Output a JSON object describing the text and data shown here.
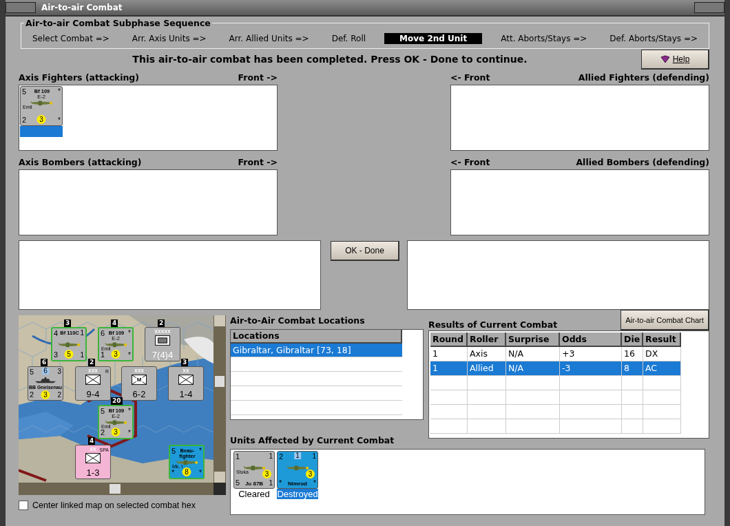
{
  "window": {
    "title": "Air-to-air Combat"
  },
  "sequence": {
    "title": "Air-to-air Combat Subphase Sequence",
    "steps": [
      {
        "label": "Select Combat =>",
        "selected": false
      },
      {
        "label": "Arr. Axis Units =>",
        "selected": false
      },
      {
        "label": "Arr. Allied Units =>",
        "selected": false
      },
      {
        "label": "Def. Roll",
        "selected": false
      },
      {
        "label": "Move 2nd Unit",
        "selected": true
      },
      {
        "label": "Att. Aborts/Stays =>",
        "selected": false
      },
      {
        "label": "Def. Aborts/Stays =>",
        "selected": false
      }
    ]
  },
  "message": "This air-to-air combat has been completed.  Press OK - Done to continue.",
  "help_button": "Help",
  "panels": [
    {
      "title": "Axis Fighters (attacking)",
      "front": "Front ->",
      "units": [
        {
          "selected": true,
          "counter": {
            "kind": "air",
            "color": "#b4b4b4",
            "tl": "5",
            "tr": "*",
            "name": "Bf 109",
            "sub": "E-2",
            "label": "Emil",
            "bl": "2",
            "mid": "3",
            "br": "*"
          }
        }
      ]
    },
    {
      "title": "Allied Fighters (defending)",
      "front": "<- Front"
    },
    {
      "title": "Axis Bombers (attacking)",
      "front": "Front ->"
    },
    {
      "title": "Allied Bombers (defending)",
      "front": "<- Front"
    }
  ],
  "ok_button": "OK - Done",
  "map": {
    "counters": [
      {
        "kind": "air",
        "color": "#b4b4b4",
        "stack": "3",
        "tl": "4",
        "tr": "1",
        "name": "Bf 110C",
        "bl": "3",
        "mid": "5",
        "br": "1"
      },
      {
        "kind": "air",
        "color": "#b4b4b4",
        "stack": "4",
        "tl": "6",
        "tr": "*",
        "name": "Bf 109",
        "sub": "E-2",
        "label": "Emil",
        "bl": "1",
        "mid": "3",
        "br": "*"
      },
      {
        "kind": "hq",
        "color": "#b4b4b4",
        "stack": "2",
        "size": "XXXXX",
        "value": "7(4)4"
      },
      {
        "kind": "naval",
        "color": "#b4b4b4",
        "stack": "6",
        "tl": "5",
        "tm": "6",
        "tr": "3",
        "name": "BB Gneisenau",
        "bl": "2",
        "mid": "3",
        "br": "2"
      },
      {
        "kind": "land",
        "color": "#b4b4b4",
        "stack": "2",
        "size": "XXX",
        "tr": "R",
        "value": "9-4"
      },
      {
        "kind": "land",
        "color": "#b4b4b4",
        "size": "XXX",
        "symbol": "M",
        "value": "6-2"
      },
      {
        "kind": "land",
        "color": "#b4b4b4",
        "stack": "3",
        "size": "XX",
        "value": "1-4"
      },
      {
        "kind": "air",
        "color": "#b4b4b4",
        "stack": "20",
        "tl": "5",
        "tr": "*",
        "name": "Bf 109",
        "sub": "E-2",
        "label": "Emil",
        "bl": "2",
        "mid": "3",
        "br": "*"
      },
      {
        "kind": "land",
        "color": "#f4b4d4",
        "stack": "4",
        "size": "XX",
        "tr": "SPA",
        "value": "1-3"
      },
      {
        "kind": "air",
        "color": "#1e9ad8",
        "tl": "5",
        "tr": "*",
        "name": "Beau-fighter",
        "label": "Mk. I",
        "bl": "*",
        "mid": "8",
        "br": "*"
      }
    ]
  },
  "center_checkbox": {
    "label": "Center linked map on selected combat hex",
    "checked": false
  },
  "locations": {
    "title": "Air-to-Air Combat Locations",
    "column": "Locations",
    "rows": [
      {
        "text": "Gibraltar, Gibraltar [73, 18]",
        "selected": true
      }
    ]
  },
  "results": {
    "title": "Results of Current Combat",
    "chart_button": "Air-to-air Combat Chart",
    "columns": [
      "Round",
      "Roller",
      "Surprise",
      "Odds",
      "Die",
      "Result"
    ],
    "rows": [
      {
        "cells": [
          "1",
          "Axis",
          "N/A",
          "+3",
          "16",
          "DX"
        ],
        "selected": false
      },
      {
        "cells": [
          "1",
          "Allied",
          "N/A",
          "-3",
          "8",
          "AC"
        ],
        "selected": true
      }
    ]
  },
  "affected": {
    "title": "Units Affected by Current Combat",
    "units": [
      {
        "status": "Cleared",
        "selected": false,
        "counter": {
          "kind": "air",
          "color": "#b4b4b4",
          "tl": "1",
          "tr": "1",
          "label": "Stuka",
          "bl": "5",
          "name2": "Ju 87B",
          "mid": "3",
          "br": "1"
        }
      },
      {
        "status": "Destroyed",
        "selected": true,
        "counter": {
          "kind": "air",
          "color": "#1e9ad8",
          "tl": "2",
          "tm": "1",
          "tr": "1",
          "bl": "*",
          "name2": "Nimrod",
          "mid": "3",
          "br": "*"
        }
      }
    ]
  }
}
